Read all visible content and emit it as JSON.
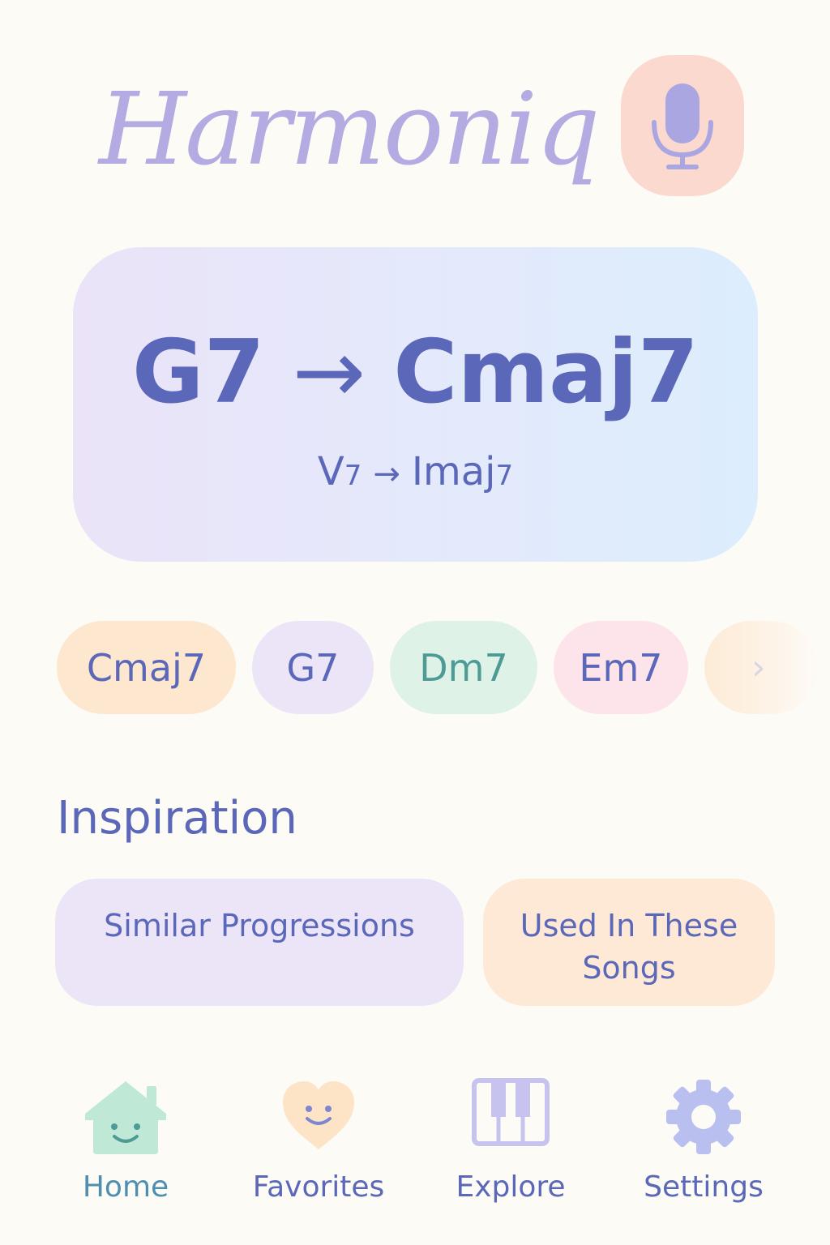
{
  "app": {
    "title": "Harmoniq"
  },
  "header": {
    "mic_icon": "microphone-icon",
    "mic_button_color": "#fbd9cf"
  },
  "progression": {
    "from_chord": "G7",
    "arrow": "→",
    "to_chord": "Cmaj7",
    "roman_from_base": "V",
    "roman_from_sub": "7",
    "roman_to_base": "Imaj",
    "roman_to_sub": "7"
  },
  "chips": [
    {
      "label": "Cmaj7",
      "color": "#fde7cf"
    },
    {
      "label": "G7",
      "color": "#ece5f8"
    },
    {
      "label": "Dm7",
      "color": "#def2e8"
    },
    {
      "label": "Em7",
      "color": "#fde4ea"
    },
    {
      "label": "›",
      "icon": "chevron-right-icon"
    }
  ],
  "inspiration": {
    "title": "Inspiration",
    "cards": [
      {
        "label": "Similar Progressions",
        "color": "#ece5f8"
      },
      {
        "label": "Used In These Songs",
        "color": "#fde9d6"
      }
    ]
  },
  "nav": {
    "items": [
      {
        "label": "Home",
        "icon": "home-icon",
        "active": true
      },
      {
        "label": "Favorites",
        "icon": "heart-icon"
      },
      {
        "label": "Explore",
        "icon": "piano-icon"
      },
      {
        "label": "Settings",
        "icon": "gear-icon"
      }
    ]
  },
  "colors": {
    "background": "#fdfbf6",
    "text_primary": "#5b67b8",
    "logo": "#b3abe2",
    "accent_teal": "#4e9b95"
  }
}
